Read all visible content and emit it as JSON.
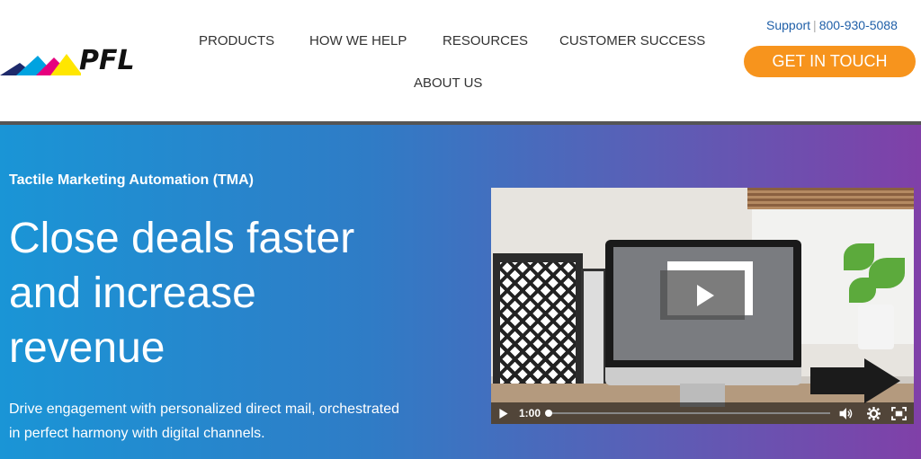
{
  "header": {
    "logo_text": "PFL",
    "nav": [
      {
        "label": "PRODUCTS"
      },
      {
        "label": "HOW WE HELP"
      },
      {
        "label": "RESOURCES"
      },
      {
        "label": "CUSTOMER SUCCESS"
      },
      {
        "label": "ABOUT US"
      }
    ],
    "support_label": "Support",
    "phone": "800-930-5088",
    "cta_label": "GET IN TOUCH"
  },
  "hero": {
    "eyebrow": "Tactile Marketing Automation (TMA)",
    "headline_lines": [
      "Close deals faster",
      "and increase",
      "revenue"
    ],
    "subtext_lines": [
      "Drive engagement with personalized direct mail, orchestrated",
      "in perfect harmony with digital channels."
    ]
  },
  "video": {
    "time": "1:00",
    "progress_fraction": 0.0,
    "icons": [
      "play-icon",
      "volume-icon",
      "settings-icon",
      "fullscreen-icon"
    ]
  },
  "colors": {
    "accent_orange": "#f7941d",
    "link_blue": "#1f5fa8",
    "hero_start": "#1a95d6",
    "hero_end": "#8040a8"
  }
}
